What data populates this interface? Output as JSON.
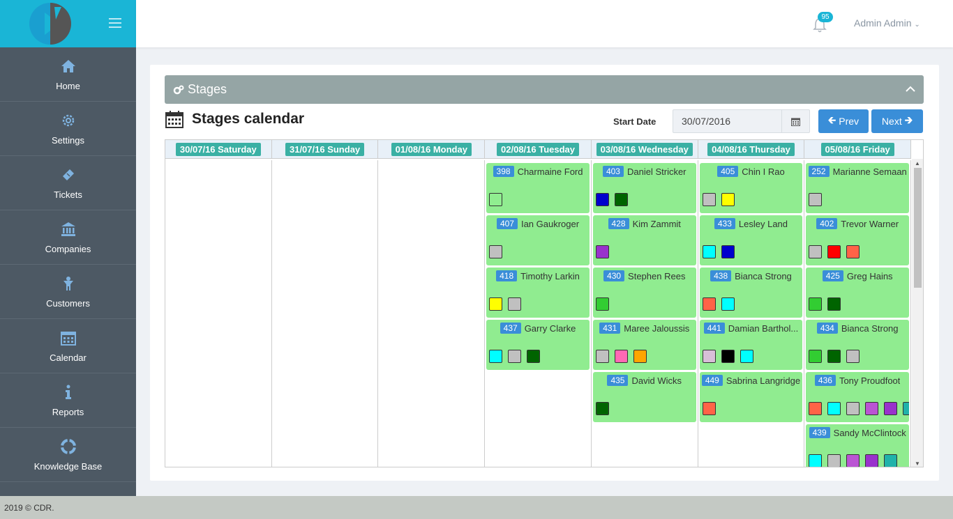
{
  "header": {
    "notif_count": "95",
    "user_name": "Admin Admin"
  },
  "sidebar": {
    "items": [
      {
        "label": "Home",
        "icon": "home-icon"
      },
      {
        "label": "Settings",
        "icon": "gear-icon"
      },
      {
        "label": "Tickets",
        "icon": "ticket-icon"
      },
      {
        "label": "Companies",
        "icon": "bank-icon"
      },
      {
        "label": "Customers",
        "icon": "person-icon"
      },
      {
        "label": "Calendar",
        "icon": "calendar-icon"
      },
      {
        "label": "Reports",
        "icon": "info-icon"
      },
      {
        "label": "Knowledge Base",
        "icon": "lifebuoy-icon"
      }
    ]
  },
  "panel": {
    "title": "Stages"
  },
  "calendar": {
    "title": "Stages calendar",
    "start_date_label": "Start Date",
    "start_date_value": "30/07/2016",
    "prev_label": "Prev",
    "next_label": "Next",
    "days": [
      {
        "label": "30/07/16 Saturday",
        "entries": []
      },
      {
        "label": "31/07/16 Sunday",
        "entries": []
      },
      {
        "label": "01/08/16 Monday",
        "entries": []
      },
      {
        "label": "02/08/16 Tuesday",
        "entries": [
          {
            "num": "398",
            "name": "Charmaine Ford",
            "colors": [
              "#90ee90"
            ]
          },
          {
            "num": "407",
            "name": "Ian Gaukroger",
            "colors": [
              "#c0c0c0"
            ]
          },
          {
            "num": "418",
            "name": "Timothy Larkin",
            "colors": [
              "#ffff00",
              "#c0c0c0"
            ]
          },
          {
            "num": "437",
            "name": "Garry Clarke",
            "colors": [
              "#00ffff",
              "#c0c0c0",
              "#006400"
            ]
          }
        ]
      },
      {
        "label": "03/08/16 Wednesday",
        "entries": [
          {
            "num": "403",
            "name": "Daniel Stricker",
            "colors": [
              "#0000cd",
              "#006400"
            ]
          },
          {
            "num": "428",
            "name": "Kim Zammit",
            "colors": [
              "#9932cc"
            ]
          },
          {
            "num": "430",
            "name": "Stephen Rees",
            "colors": [
              "#32cd32"
            ]
          },
          {
            "num": "431",
            "name": "Maree Jaloussis",
            "colors": [
              "#c0c0c0",
              "#ff69b4",
              "#ffa500"
            ]
          },
          {
            "num": "435",
            "name": "David Wicks",
            "colors": [
              "#006400"
            ]
          }
        ]
      },
      {
        "label": "04/08/16 Thursday",
        "entries": [
          {
            "num": "405",
            "name": "Chin I Rao",
            "colors": [
              "#c0c0c0",
              "#ffff00"
            ]
          },
          {
            "num": "433",
            "name": "Lesley Land",
            "colors": [
              "#00ffff",
              "#0000cd"
            ]
          },
          {
            "num": "438",
            "name": "Bianca Strong",
            "colors": [
              "#ff6347",
              "#00ffff"
            ]
          },
          {
            "num": "441",
            "name": "Damian Barthol...",
            "colors": [
              "#d8bfd8",
              "#000000",
              "#00ffff"
            ]
          },
          {
            "num": "449",
            "name": "Sabrina Langridge",
            "colors": [
              "#ff6347"
            ]
          }
        ]
      },
      {
        "label": "05/08/16 Friday",
        "entries": [
          {
            "num": "252",
            "name": "Marianne Semaan",
            "colors": [
              "#c0c0c0"
            ]
          },
          {
            "num": "402",
            "name": "Trevor Warner",
            "colors": [
              "#c0c0c0",
              "#ff0000",
              "#ff6347"
            ]
          },
          {
            "num": "425",
            "name": "Greg Hains",
            "colors": [
              "#32cd32",
              "#006400"
            ]
          },
          {
            "num": "434",
            "name": "Bianca Strong",
            "colors": [
              "#32cd32",
              "#006400",
              "#c0c0c0"
            ]
          },
          {
            "num": "436",
            "name": "Tony Proudfoot",
            "colors": [
              "#ff6347",
              "#00ffff",
              "#c0c0c0",
              "#ba55d3",
              "#9932cc",
              "#20b2aa"
            ]
          },
          {
            "num": "439",
            "name": "Sandy McClintock",
            "colors": [
              "#00ffff",
              "#c0c0c0",
              "#ba55d3",
              "#9932cc",
              "#20b2aa"
            ]
          }
        ]
      }
    ]
  },
  "footer": {
    "text": "2019 © CDR."
  }
}
